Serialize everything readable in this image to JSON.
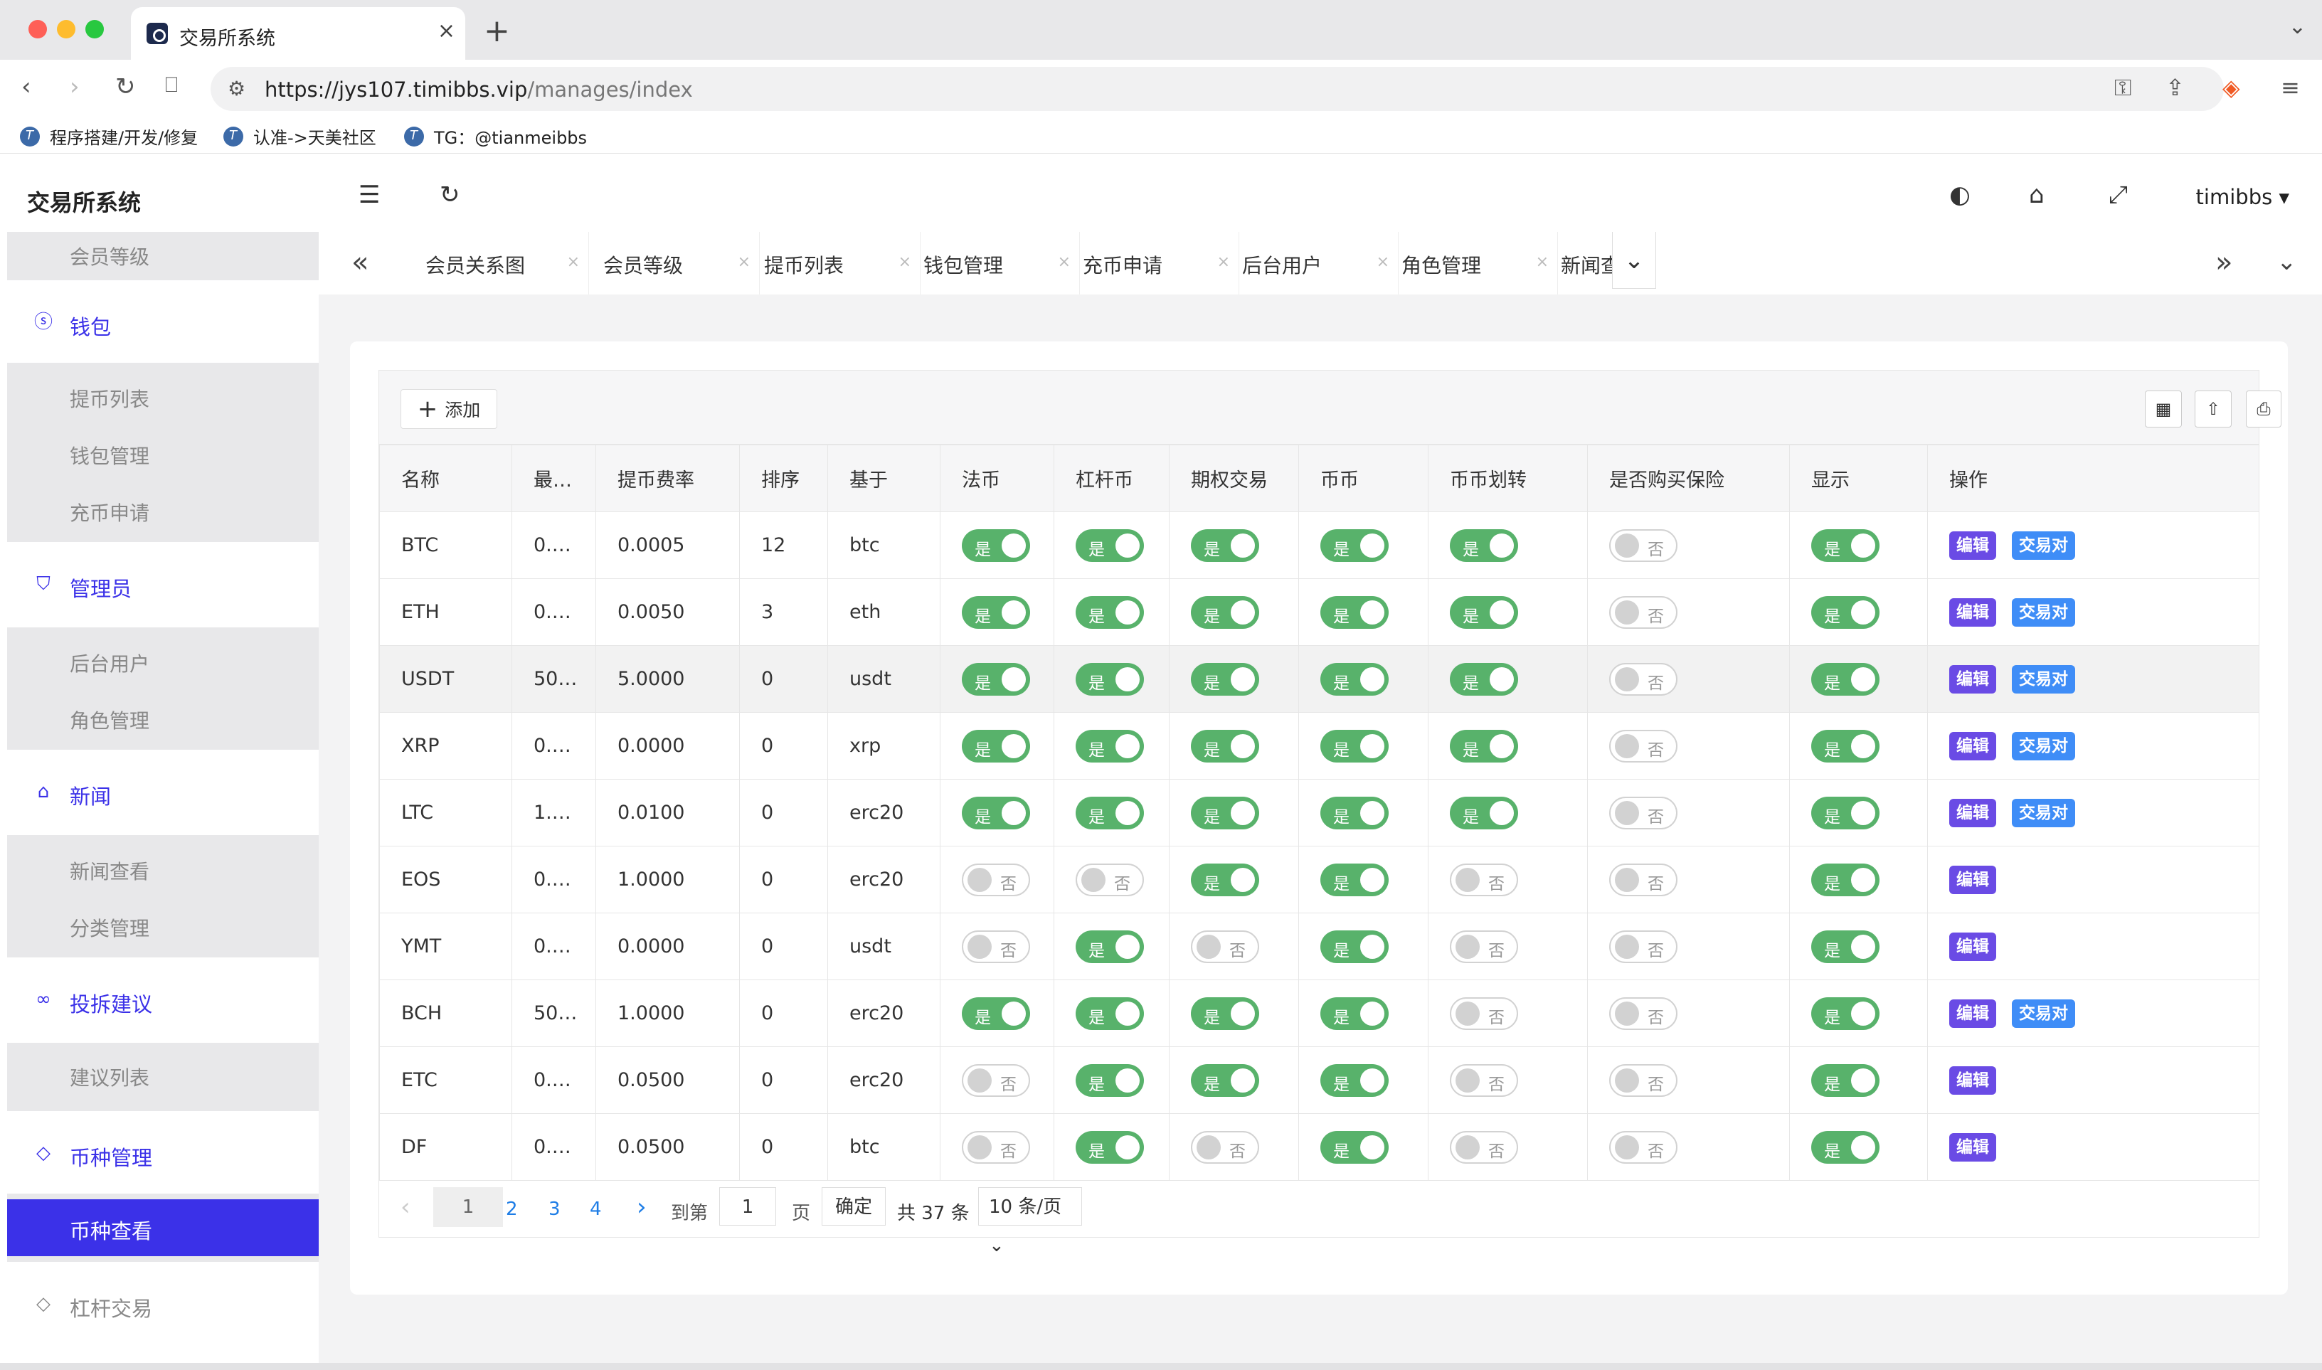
{
  "browser": {
    "tab_title": "交易所系统",
    "url_host": "https://jys107.timibbs.vip",
    "url_path": "/manages/index",
    "bookmarks": [
      "程序搭建/开发/修复",
      "认准->天美社区",
      "TG：@tianmeibbs"
    ]
  },
  "app": {
    "title": "交易所系统",
    "user": "timibbs"
  },
  "sidebar": {
    "top_sub": "会员等级",
    "wallet": {
      "label": "钱包",
      "items": [
        "提币列表",
        "钱包管理",
        "充币申请"
      ]
    },
    "admin": {
      "label": "管理员",
      "items": [
        "后台用户",
        "角色管理"
      ]
    },
    "news": {
      "label": "新闻",
      "items": [
        "新闻查看",
        "分类管理"
      ]
    },
    "complaint": {
      "label": "投拆建议",
      "items": [
        "建议列表"
      ]
    },
    "coin": {
      "label": "币种管理",
      "items": [
        "币种查看"
      ]
    },
    "leverage": {
      "label": "杠杆交易"
    }
  },
  "tabs": [
    "会员关系图",
    "会员等级",
    "提币列表",
    "钱包管理",
    "充币申请",
    "后台用户",
    "角色管理",
    "新闻查"
  ],
  "toolbar": {
    "add_label": "添加"
  },
  "table": {
    "headers": [
      "名称",
      "最…",
      "提币费率",
      "排序",
      "基于",
      "法币",
      "杠杆币",
      "期权交易",
      "币币",
      "币币划转",
      "是否购买保险",
      "显示",
      "操作"
    ],
    "on_label": "是",
    "off_label": "否",
    "edit_label": "编辑",
    "pair_label": "交易对",
    "rows": [
      {
        "name": "BTC",
        "min": "0.…",
        "fee": "0.0005",
        "sort": "12",
        "base": "btc",
        "sw": [
          1,
          1,
          1,
          1,
          1,
          0,
          1
        ],
        "pair": true
      },
      {
        "name": "ETH",
        "min": "0.…",
        "fee": "0.0050",
        "sort": "3",
        "base": "eth",
        "sw": [
          1,
          1,
          1,
          1,
          1,
          0,
          1
        ],
        "pair": true
      },
      {
        "name": "USDT",
        "min": "50…",
        "fee": "5.0000",
        "sort": "0",
        "base": "usdt",
        "sw": [
          1,
          1,
          1,
          1,
          1,
          0,
          1
        ],
        "pair": true
      },
      {
        "name": "XRP",
        "min": "0.…",
        "fee": "0.0000",
        "sort": "0",
        "base": "xrp",
        "sw": [
          1,
          1,
          1,
          1,
          1,
          0,
          1
        ],
        "pair": true
      },
      {
        "name": "LTC",
        "min": "1.…",
        "fee": "0.0100",
        "sort": "0",
        "base": "erc20",
        "sw": [
          1,
          1,
          1,
          1,
          1,
          0,
          1
        ],
        "pair": true
      },
      {
        "name": "EOS",
        "min": "0.…",
        "fee": "1.0000",
        "sort": "0",
        "base": "erc20",
        "sw": [
          0,
          0,
          1,
          1,
          0,
          0,
          1
        ],
        "pair": false
      },
      {
        "name": "YMT",
        "min": "0.…",
        "fee": "0.0000",
        "sort": "0",
        "base": "usdt",
        "sw": [
          0,
          1,
          0,
          1,
          0,
          0,
          1
        ],
        "pair": false
      },
      {
        "name": "BCH",
        "min": "50…",
        "fee": "1.0000",
        "sort": "0",
        "base": "erc20",
        "sw": [
          1,
          1,
          1,
          1,
          0,
          0,
          1
        ],
        "pair": true
      },
      {
        "name": "ETC",
        "min": "0.…",
        "fee": "0.0500",
        "sort": "0",
        "base": "erc20",
        "sw": [
          0,
          1,
          1,
          1,
          0,
          0,
          1
        ],
        "pair": false
      },
      {
        "name": "DF",
        "min": "0.…",
        "fee": "0.0500",
        "sort": "0",
        "base": "btc",
        "sw": [
          0,
          1,
          0,
          1,
          0,
          0,
          1
        ],
        "pair": false
      }
    ]
  },
  "pager": {
    "pages": [
      "1",
      "2",
      "3",
      "4"
    ],
    "goto_label": "到第",
    "goto_value": "1",
    "page_unit": "页",
    "confirm": "确定",
    "total": "共 37 条",
    "page_size": "10 条/页"
  }
}
